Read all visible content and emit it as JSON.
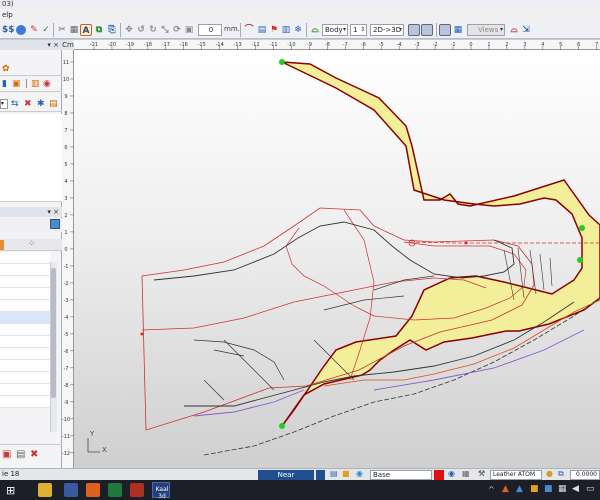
{
  "window": {
    "title_fragment": "03)"
  },
  "menu": {
    "help_fragment": "elp"
  },
  "toolbar": {
    "mm_label": "mm.",
    "stepper_value": "0",
    "body_select": "Body",
    "number_select": "1",
    "mode_select": "2D->3D",
    "views_select": "Views"
  },
  "left_panel": {
    "close_glyph": "×"
  },
  "ruler": {
    "units_corner": "Cm",
    "h_ticks": [
      "-21",
      "-20",
      "-19",
      "-18",
      "-17",
      "-16",
      "-15",
      "-14",
      "-13",
      "-12",
      "-11",
      "-10",
      "-9",
      "-8",
      "-7",
      "-6",
      "-5",
      "-4",
      "-3",
      "-2",
      "-1",
      "0",
      "1",
      "2",
      "3",
      "4",
      "5",
      "6",
      "7"
    ],
    "v_ticks": [
      "11",
      "10",
      "9",
      "8",
      "7",
      "6",
      "5",
      "4",
      "3",
      "2",
      "1",
      "0",
      "-1",
      "-2",
      "-3",
      "-4",
      "-5",
      "-6",
      "-7",
      "-8",
      "-9",
      "-10",
      "-11",
      "-12"
    ]
  },
  "canvas": {
    "axis_y_label": "Y",
    "axis_x_label": "X",
    "colors": {
      "fill": "#f3ee9a",
      "outline": "#8b0000",
      "pattern": "#d03030",
      "last": "#333333",
      "marker": "#22cc22"
    }
  },
  "status": {
    "left_text": "ie 18",
    "snap_select": "Near",
    "layer_select": "Base",
    "material_select": "Leather ATOM",
    "value_field": "0.0000"
  },
  "taskbar": {
    "app_label": "Kaal 3d"
  }
}
